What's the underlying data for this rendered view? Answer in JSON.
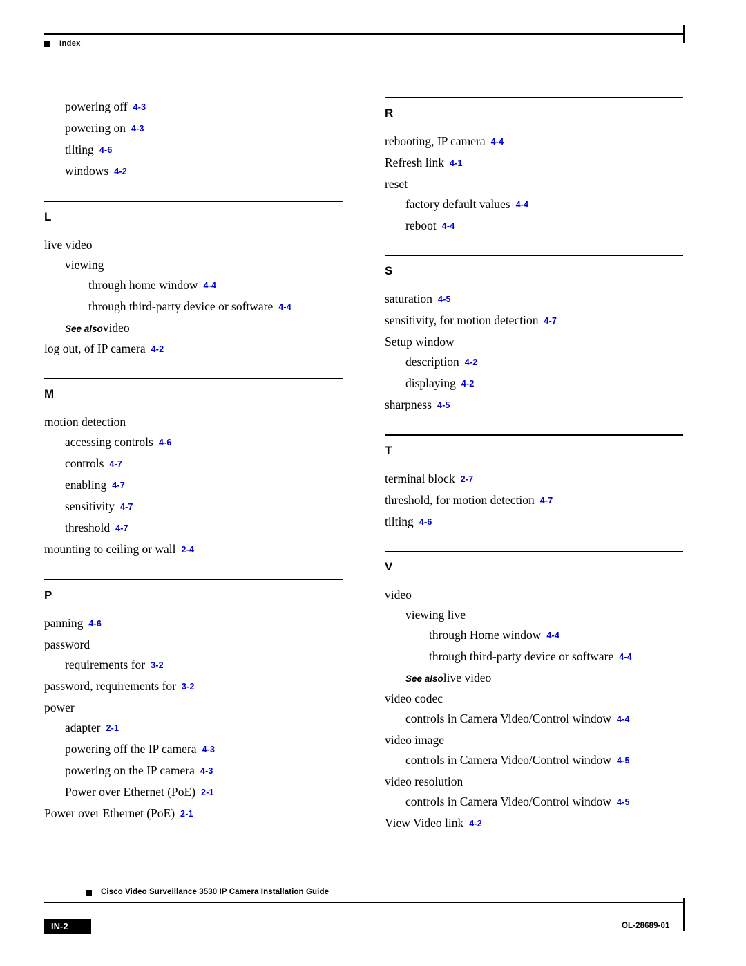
{
  "header": {
    "label": "Index"
  },
  "footer": {
    "guide_title": "Cisco Video Surveillance 3530 IP Camera Installation Guide",
    "page_number": "IN-2",
    "doc_id": "OL-28689-01"
  },
  "columns": [
    {
      "name": "left",
      "blocks": [
        {
          "type": "entries",
          "entries": [
            {
              "level": 1,
              "text": "powering off",
              "page": "4-3"
            },
            {
              "level": 1,
              "text": "powering on",
              "page": "4-3"
            },
            {
              "level": 1,
              "text": "tilting",
              "page": "4-6"
            },
            {
              "level": 1,
              "text": "windows",
              "page": "4-2"
            }
          ]
        },
        {
          "type": "letter",
          "letter": "L",
          "entries": [
            {
              "level": 0,
              "text": "live video",
              "page": ""
            },
            {
              "level": 1,
              "text": "viewing",
              "page": ""
            },
            {
              "level": 2,
              "text": "through home window",
              "page": "4-4"
            },
            {
              "level": 2,
              "text": "through third-party device or software",
              "page": "4-4"
            },
            {
              "level": 1,
              "text": "See also",
              "see_also": "video",
              "page": ""
            },
            {
              "level": 0,
              "text": "log out, of IP camera",
              "page": "4-2"
            }
          ]
        },
        {
          "type": "letter",
          "letter": "M",
          "entries": [
            {
              "level": 0,
              "text": "motion detection",
              "page": ""
            },
            {
              "level": 1,
              "text": "accessing controls",
              "page": "4-6"
            },
            {
              "level": 1,
              "text": "controls",
              "page": "4-7"
            },
            {
              "level": 1,
              "text": "enabling",
              "page": "4-7"
            },
            {
              "level": 1,
              "text": "sensitivity",
              "page": "4-7"
            },
            {
              "level": 1,
              "text": "threshold",
              "page": "4-7"
            },
            {
              "level": 0,
              "text": "mounting to ceiling or wall",
              "page": "2-4"
            }
          ]
        },
        {
          "type": "letter",
          "letter": "P",
          "entries": [
            {
              "level": 0,
              "text": "panning",
              "page": "4-6"
            },
            {
              "level": 0,
              "text": "password",
              "page": ""
            },
            {
              "level": 1,
              "text": "requirements for",
              "page": "3-2"
            },
            {
              "level": 0,
              "text": "password, requirements for",
              "page": "3-2"
            },
            {
              "level": 0,
              "text": "power",
              "page": ""
            },
            {
              "level": 1,
              "text": "adapter",
              "page": "2-1"
            },
            {
              "level": 1,
              "text": "powering off the IP camera",
              "page": "4-3"
            },
            {
              "level": 1,
              "text": "powering on the IP camera",
              "page": "4-3"
            },
            {
              "level": 1,
              "text": "Power over Ethernet (PoE)",
              "page": "2-1"
            },
            {
              "level": 0,
              "text": "Power over Ethernet (PoE)",
              "page": "2-1"
            }
          ]
        }
      ]
    },
    {
      "name": "right",
      "blocks": [
        {
          "type": "letter",
          "letter": "R",
          "first": true,
          "entries": [
            {
              "level": 0,
              "text": "rebooting, IP camera",
              "page": "4-4"
            },
            {
              "level": 0,
              "text": "Refresh link",
              "page": "4-1"
            },
            {
              "level": 0,
              "text": "reset",
              "page": ""
            },
            {
              "level": 1,
              "text": "factory default values",
              "page": "4-4"
            },
            {
              "level": 1,
              "text": "reboot",
              "page": "4-4"
            }
          ]
        },
        {
          "type": "letter",
          "letter": "S",
          "entries": [
            {
              "level": 0,
              "text": "saturation",
              "page": "4-5"
            },
            {
              "level": 0,
              "text": "sensitivity, for motion detection",
              "page": "4-7"
            },
            {
              "level": 0,
              "text": "Setup window",
              "page": ""
            },
            {
              "level": 1,
              "text": "description",
              "page": "4-2"
            },
            {
              "level": 1,
              "text": "displaying",
              "page": "4-2"
            },
            {
              "level": 0,
              "text": "sharpness",
              "page": "4-5"
            }
          ]
        },
        {
          "type": "letter",
          "letter": "T",
          "entries": [
            {
              "level": 0,
              "text": "terminal block",
              "page": "2-7"
            },
            {
              "level": 0,
              "text": "threshold, for motion detection",
              "page": "4-7"
            },
            {
              "level": 0,
              "text": "tilting",
              "page": "4-6"
            }
          ]
        },
        {
          "type": "letter",
          "letter": "V",
          "entries": [
            {
              "level": 0,
              "text": "video",
              "page": ""
            },
            {
              "level": 1,
              "text": "viewing live",
              "page": ""
            },
            {
              "level": 2,
              "text": "through Home window",
              "page": "4-4"
            },
            {
              "level": 2,
              "text": "through third-party device or software",
              "page": "4-4"
            },
            {
              "level": 1,
              "text": "See also",
              "see_also": "live video",
              "page": ""
            },
            {
              "level": 0,
              "text": "video codec",
              "page": ""
            },
            {
              "level": 1,
              "text": "controls in Camera Video/Control window",
              "page": "4-4"
            },
            {
              "level": 0,
              "text": "video image",
              "page": ""
            },
            {
              "level": 1,
              "text": "controls in Camera Video/Control window",
              "page": "4-5"
            },
            {
              "level": 0,
              "text": "video resolution",
              "page": ""
            },
            {
              "level": 1,
              "text": "controls in Camera Video/Control window",
              "page": "4-5"
            },
            {
              "level": 0,
              "text": "View Video link",
              "page": "4-2"
            }
          ]
        }
      ]
    }
  ],
  "colors": {
    "page_ref": "#0000CC",
    "text": "#000000"
  }
}
